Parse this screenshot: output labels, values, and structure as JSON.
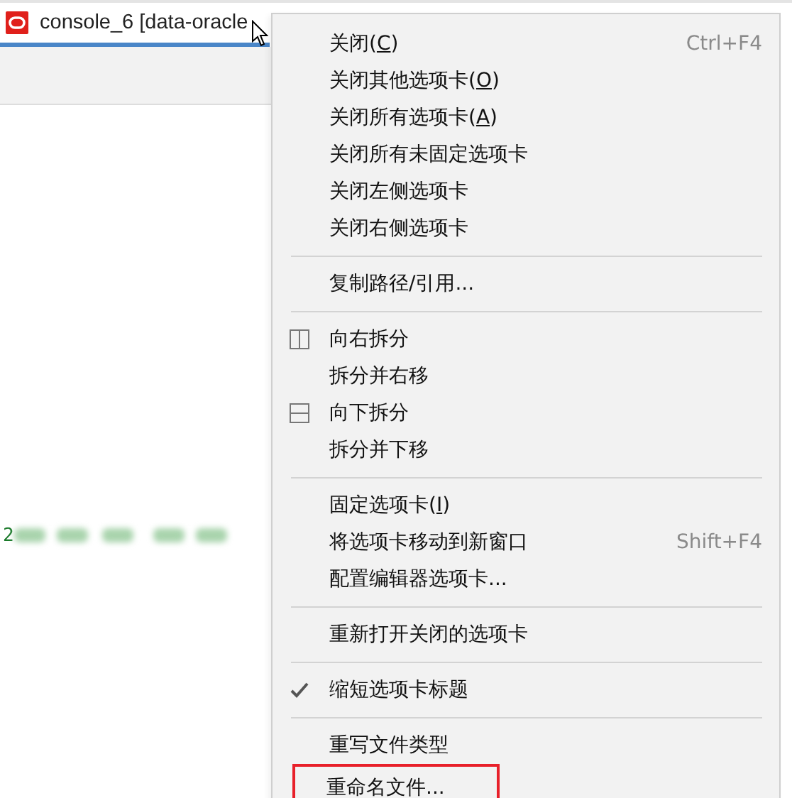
{
  "tab": {
    "title": "console_6 [data-oracle",
    "selected": true
  },
  "editor": {
    "code_fragment": "2"
  },
  "menu": {
    "groups": [
      [
        {
          "label": "关闭(",
          "mnemonic": "C",
          "label_end": ")",
          "shortcut": "Ctrl+F4",
          "checked": false,
          "highlighted": false
        },
        {
          "label": "关闭其他选项卡(",
          "mnemonic": "O",
          "label_end": ")",
          "checked": false,
          "highlighted": false
        },
        {
          "label": "关闭所有选项卡(",
          "mnemonic": "A",
          "label_end": ")",
          "checked": false,
          "highlighted": false
        },
        {
          "label": "关闭所有未固定选项卡",
          "checked": false,
          "highlighted": false
        },
        {
          "label": "关闭左侧选项卡",
          "checked": false,
          "highlighted": false
        },
        {
          "label": "关闭右侧选项卡",
          "checked": false,
          "highlighted": false
        }
      ],
      [
        {
          "label": "复制路径/引用...",
          "checked": false,
          "highlighted": false
        }
      ],
      [
        {
          "label": "向右拆分",
          "kind": "split-right",
          "checked": false,
          "highlighted": false
        },
        {
          "label": "拆分并右移",
          "checked": false,
          "highlighted": false
        },
        {
          "label": "向下拆分",
          "kind": "split-down",
          "checked": false,
          "highlighted": false
        },
        {
          "label": "拆分并下移",
          "checked": false,
          "highlighted": false
        }
      ],
      [
        {
          "label": "固定选项卡(",
          "mnemonic": "I",
          "label_end": ")",
          "checked": false,
          "highlighted": false
        },
        {
          "label": "将选项卡移动到新窗口",
          "shortcut": "Shift+F4",
          "checked": false,
          "highlighted": false
        },
        {
          "label": "配置编辑器选项卡...",
          "checked": false,
          "highlighted": false
        }
      ],
      [
        {
          "label": "重新打开关闭的选项卡",
          "checked": false,
          "highlighted": false
        }
      ],
      [
        {
          "label": "缩短选项卡标题",
          "checked": true,
          "highlighted": false
        }
      ],
      [
        {
          "label": "重写文件类型",
          "checked": false,
          "highlighted": false
        },
        {
          "label": "重命名文件...",
          "checked": false,
          "highlighted": true
        }
      ]
    ]
  }
}
